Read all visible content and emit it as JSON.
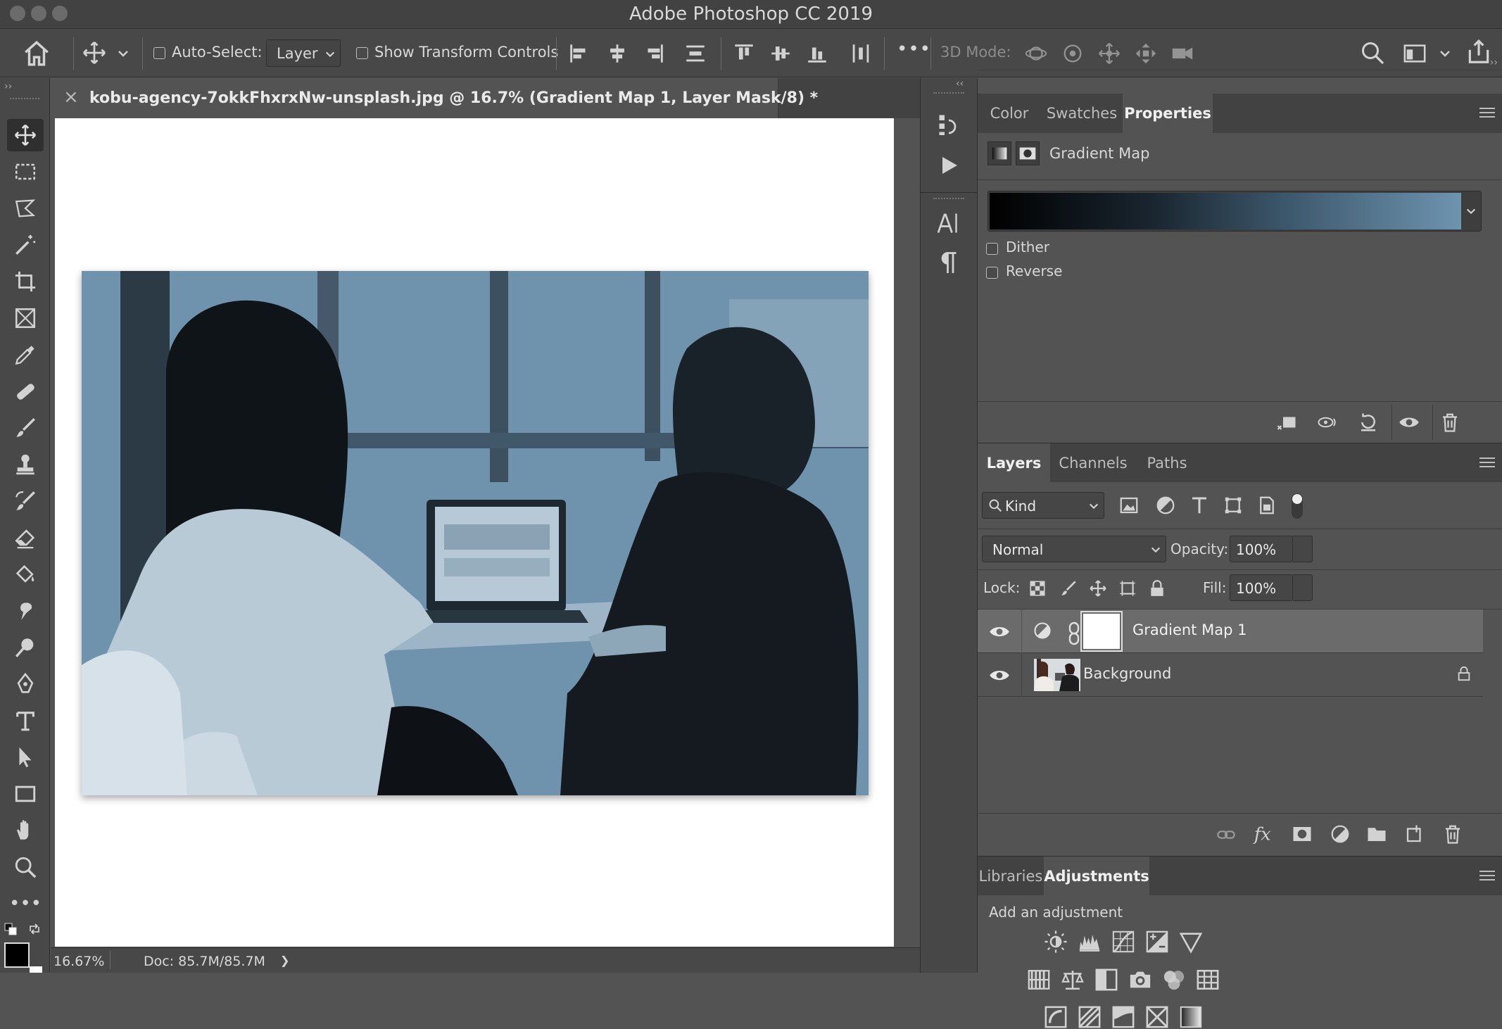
{
  "app": {
    "title": "Adobe Photoshop CC 2019"
  },
  "options": {
    "auto_select_label": "Auto-Select:",
    "auto_select_checked": false,
    "auto_select_value": "Layer",
    "show_transform_label": "Show Transform Controls",
    "show_transform_checked": false,
    "more_label": "•••",
    "mode_3d_label": "3D Mode:"
  },
  "document": {
    "tab_title": "kobu-agency-7okkFhxrxNw-unsplash.jpg @ 16.7% (Gradient Map 1, Layer Mask/8) *",
    "close_glyph": "×",
    "tint_color": "#6f93ad"
  },
  "status": {
    "zoom": "16.67%",
    "doc_size": "Doc: 85.7M/85.7M",
    "arrow": "❯"
  },
  "properties_panel": {
    "tabs": [
      "Color",
      "Swatches",
      "Properties"
    ],
    "active_tab": "Properties",
    "header": "Gradient Map",
    "gradient": {
      "from": "#000000",
      "to": "#6e94b0"
    },
    "dither_label": "Dither",
    "dither_checked": false,
    "reverse_label": "Reverse",
    "reverse_checked": false
  },
  "layers_panel": {
    "tabs": [
      "Layers",
      "Channels",
      "Paths"
    ],
    "active_tab": "Layers",
    "filter_kind": "Kind",
    "blend_mode": "Normal",
    "opacity_label": "Opacity:",
    "opacity_value": "100%",
    "lock_label": "Lock:",
    "fill_label": "Fill:",
    "fill_value": "100%",
    "layers": [
      {
        "name": "Gradient Map 1",
        "visible": true,
        "selected": true,
        "locked": false
      },
      {
        "name": "Background",
        "visible": true,
        "selected": false,
        "locked": true
      }
    ]
  },
  "adjustments_panel": {
    "tabs": [
      "Libraries",
      "Adjustments"
    ],
    "active_tab": "Adjustments",
    "add_label": "Add an adjustment"
  },
  "colors": {
    "ui_bg": "#535353",
    "panel_dark": "#424242",
    "text": "#d8d8d8"
  }
}
